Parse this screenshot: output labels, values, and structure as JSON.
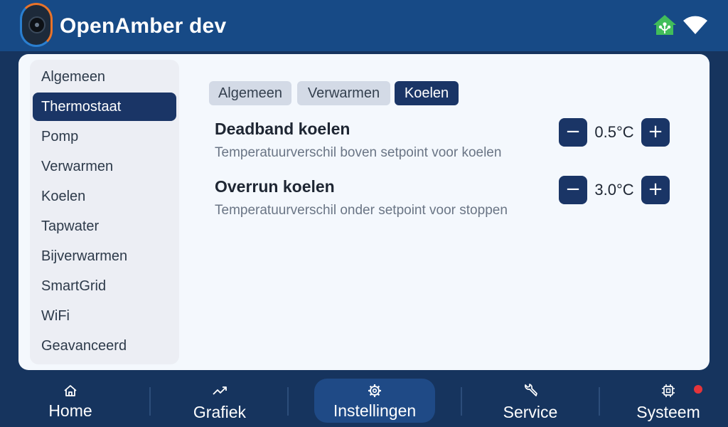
{
  "header": {
    "title": "OpenAmber dev",
    "logo_icon": "heatpump-logo-icon",
    "status_icons": [
      "home-assistant-icon",
      "wifi-icon"
    ]
  },
  "sidebar": {
    "items": [
      {
        "label": "Algemeen"
      },
      {
        "label": "Thermostaat",
        "active": true
      },
      {
        "label": "Pomp"
      },
      {
        "label": "Verwarmen"
      },
      {
        "label": "Koelen"
      },
      {
        "label": "Tapwater"
      },
      {
        "label": "Bijverwarmen"
      },
      {
        "label": "SmartGrid"
      },
      {
        "label": "WiFi"
      },
      {
        "label": "Geavanceerd"
      }
    ]
  },
  "tabs": [
    {
      "label": "Algemeen"
    },
    {
      "label": "Verwarmen"
    },
    {
      "label": "Koelen",
      "active": true
    }
  ],
  "settings": [
    {
      "title": "Deadband koelen",
      "description": "Temperatuurverschil boven setpoint voor koelen",
      "value": "0.5°C",
      "minus": "−",
      "plus": "+"
    },
    {
      "title": "Overrun koelen",
      "description": "Temperatuurverschil onder setpoint voor stoppen",
      "value": "3.0°C",
      "minus": "−",
      "plus": "+"
    }
  ],
  "nav": [
    {
      "label": "Home",
      "icon": "home-icon"
    },
    {
      "label": "Grafiek",
      "icon": "chart-icon"
    },
    {
      "label": "Instellingen",
      "icon": "gear-icon",
      "active": true
    },
    {
      "label": "Service",
      "icon": "wrench-icon"
    },
    {
      "label": "Systeem",
      "icon": "chip-icon",
      "alert": true
    }
  ],
  "colors": {
    "header_bg": "#174a86",
    "page_bg": "#16345e",
    "accent": "#1a3566",
    "ha_green": "#41bd5a",
    "alert_red": "#e5343a"
  }
}
